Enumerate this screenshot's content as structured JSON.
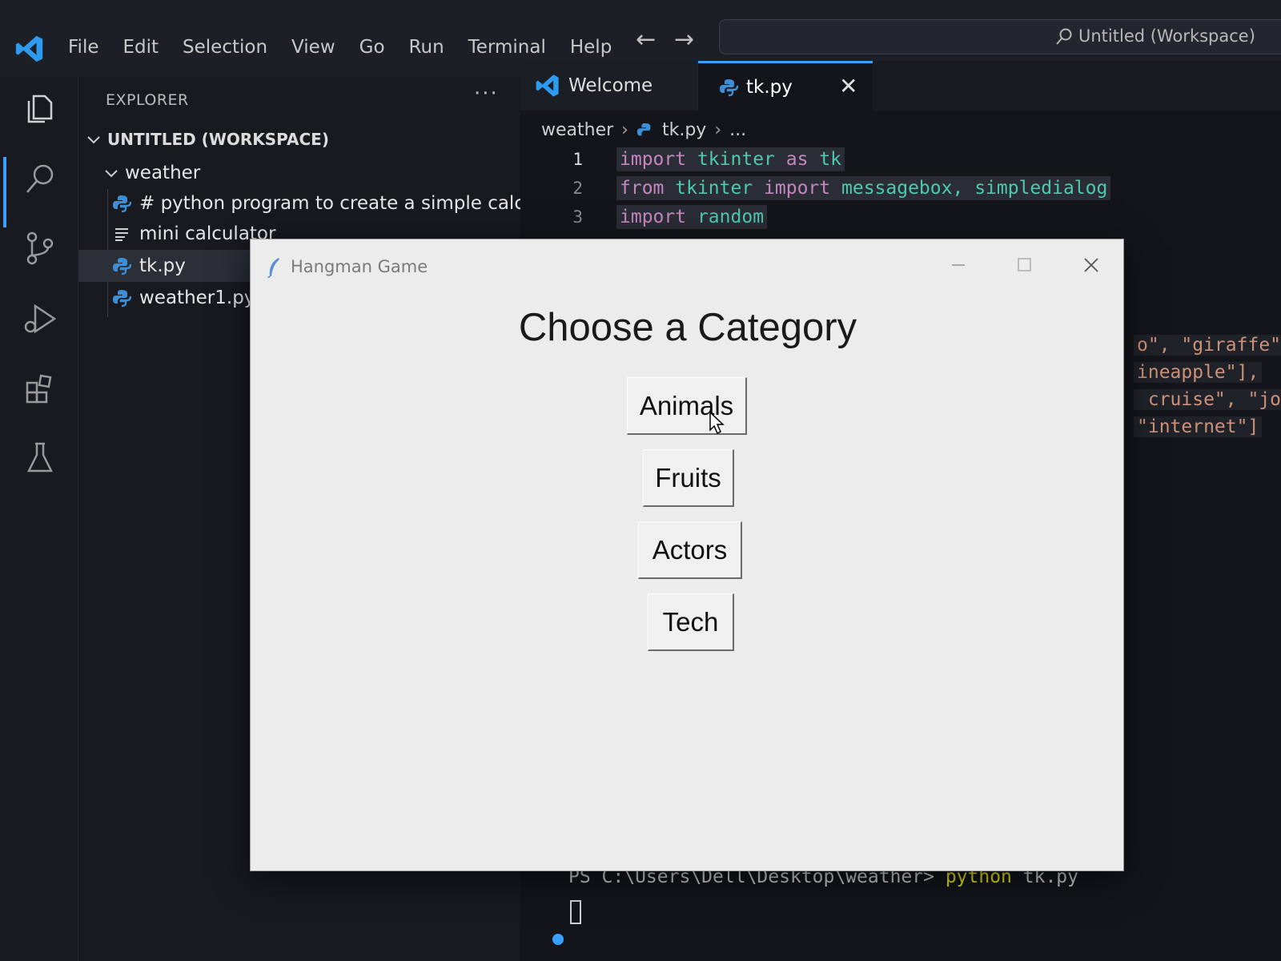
{
  "menu": [
    "File",
    "Edit",
    "Selection",
    "View",
    "Go",
    "Run",
    "Terminal",
    "Help"
  ],
  "command_center": {
    "label": "Untitled (Workspace)"
  },
  "explorer": {
    "title": "EXPLORER",
    "more": "···",
    "workspace": "UNTITLED (WORKSPACE)",
    "folder": "weather",
    "files": [
      {
        "name": "# python program to create a simple calc.py",
        "icon": "python-icon"
      },
      {
        "name": "mini calculator",
        "icon": "text-file-icon"
      },
      {
        "name": "tk.py",
        "icon": "python-icon",
        "selected": true
      },
      {
        "name": "weather1.py",
        "icon": "python-icon"
      }
    ]
  },
  "tabs": [
    {
      "label": "Welcome",
      "icon": "vscode-icon"
    },
    {
      "label": "tk.py",
      "icon": "python-icon",
      "active": true,
      "close": "✕"
    }
  ],
  "breadcrumb": {
    "folder": "weather",
    "file": "tk.py",
    "more": "..."
  },
  "code": {
    "line_numbers": [
      "1",
      "2",
      "3"
    ],
    "line1": {
      "kw1": "import",
      "mod1": "tkinter",
      "kw2": "as",
      "mod2": "tk"
    },
    "line2": {
      "kw1": "from",
      "mod1": "tkinter",
      "kw2": "import",
      "mod2": "messagebox,",
      "mod3": "simpledialog"
    },
    "line3": {
      "kw1": "import",
      "mod1": "random"
    },
    "right_fragments": [
      {
        "a": "o\",",
        "b": " \"giraffe\"]"
      },
      {
        "a": "ineapple\"],",
        "b": ""
      },
      {
        "a": " cruise\",",
        "b": " \"job"
      },
      {
        "a": "\"internet\"]",
        "b": ""
      }
    ]
  },
  "terminal": {
    "prompt": "PS C:\\Users\\Dell\\Desktop\\weather> ",
    "command": "python",
    "args": " tk.py"
  },
  "tk_window": {
    "title": "Hangman Game",
    "heading": "Choose a Category",
    "buttons": [
      "Animals",
      "Fruits",
      "Actors",
      "Tech"
    ]
  },
  "colors": {
    "accent": "#3aa0ff",
    "keyword": "#c586c0",
    "module": "#4ec9b0",
    "string": "#ce9178",
    "terminal_command": "#e5e510"
  }
}
